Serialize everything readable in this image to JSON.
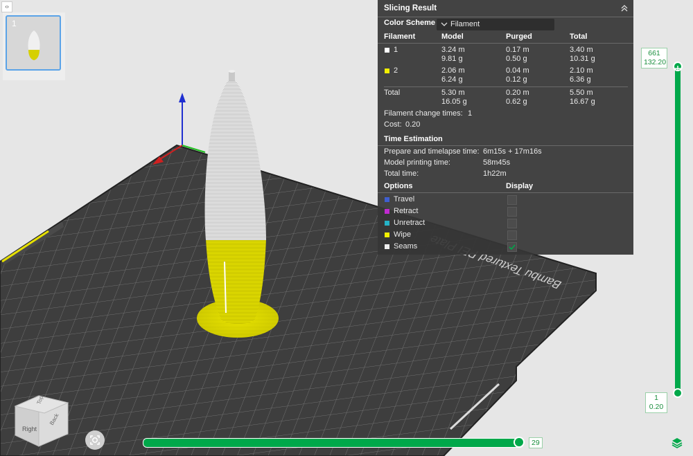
{
  "thumbnail": {
    "plate_number": "1"
  },
  "plate_label": "Bambu Textured PEI Plate",
  "slicing_result": {
    "title": "Slicing Result",
    "color_scheme_label": "Color Scheme",
    "color_scheme_value": "Filament",
    "columns": [
      "Filament",
      "Model",
      "Purged",
      "Total"
    ],
    "filaments": [
      {
        "id": "1",
        "color": "#ffffff",
        "model_len": "3.24 m",
        "model_wt": "9.81 g",
        "purged_len": "0.17 m",
        "purged_wt": "0.50 g",
        "total_len": "3.40 m",
        "total_wt": "10.31 g"
      },
      {
        "id": "2",
        "color": "#f2ef00",
        "model_len": "2.06 m",
        "model_wt": "6.24 g",
        "purged_len": "0.04 m",
        "purged_wt": "0.12 g",
        "total_len": "2.10 m",
        "total_wt": "6.36 g"
      }
    ],
    "total": {
      "label": "Total",
      "model_len": "5.30 m",
      "model_wt": "16.05 g",
      "purged_len": "0.20 m",
      "purged_wt": "0.62 g",
      "total_len": "5.50 m",
      "total_wt": "16.67 g"
    },
    "filament_change_label": "Filament change times:",
    "filament_change_value": "1",
    "cost_label": "Cost:",
    "cost_value": "0.20"
  },
  "time_estimation": {
    "title": "Time Estimation",
    "rows": [
      {
        "label": "Prepare and timelapse time:",
        "value": "6m15s + 17m16s"
      },
      {
        "label": "Model printing time:",
        "value": "58m45s"
      },
      {
        "label": "Total time:",
        "value": "1h22m"
      }
    ]
  },
  "options": {
    "header_options": "Options",
    "header_display": "Display",
    "items": [
      {
        "label": "Travel",
        "color": "#3f5fd0",
        "checked": false
      },
      {
        "label": "Retract",
        "color": "#c02ad0",
        "checked": false
      },
      {
        "label": "Unretract",
        "color": "#25b3c7",
        "checked": false
      },
      {
        "label": "Wipe",
        "color": "#f2ef00",
        "checked": false
      },
      {
        "label": "Seams",
        "color": "#eeeeee",
        "checked": true
      }
    ]
  },
  "layer_slider": {
    "top_layer": "661",
    "top_height": "132.20",
    "bottom_layer": "1",
    "bottom_height": "0.20"
  },
  "move_slider": {
    "value": "29"
  },
  "nav_cube": {
    "top": "Top",
    "right": "Right",
    "back": "Back"
  },
  "colors": {
    "accent_green": "#00a84a",
    "panel_bg": "#363636"
  }
}
